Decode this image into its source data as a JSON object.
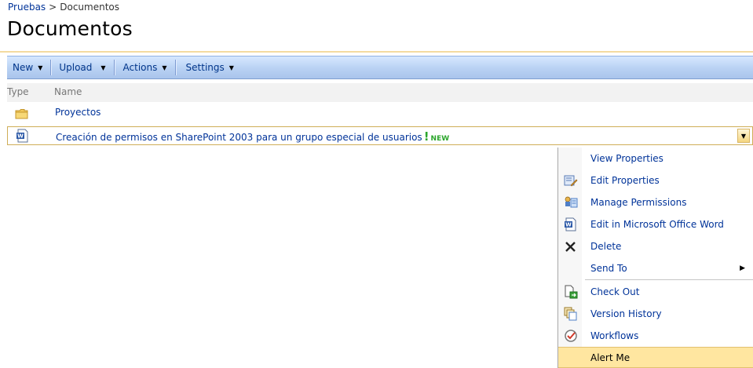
{
  "breadcrumb": {
    "parent": "Pruebas",
    "separator": ">",
    "current": "Documentos"
  },
  "page": {
    "title": "Documentos"
  },
  "toolbar": {
    "items": [
      {
        "label": "New",
        "icon": "chevron-down-icon"
      },
      {
        "label": "Upload",
        "icon": "chevron-down-icon"
      },
      {
        "label": "Actions",
        "icon": "chevron-down-icon"
      },
      {
        "label": "Settings",
        "icon": "chevron-down-icon"
      }
    ]
  },
  "list": {
    "columns": {
      "type": "Type",
      "name": "Name"
    },
    "rows": [
      {
        "type_icon": "folder-icon",
        "name": "Proyectos"
      },
      {
        "type_icon": "word-document-icon",
        "name": "Creación de permisos en SharePoint 2003 para un grupo especial de usuarios",
        "new_mark": "!",
        "new_label": "NEW"
      }
    ]
  },
  "context_menu": {
    "items": [
      {
        "label": "View Properties",
        "icon": ""
      },
      {
        "label": "Edit Properties",
        "icon": "edit-properties-icon"
      },
      {
        "label": "Manage Permissions",
        "icon": "manage-permissions-icon"
      },
      {
        "label": "Edit in Microsoft Office Word",
        "icon": "word-document-icon"
      },
      {
        "label": "Delete",
        "icon": "delete-x-icon"
      },
      {
        "label": "Send To",
        "icon": "",
        "submenu_arrow": "▶"
      },
      {
        "label": "Check Out",
        "icon": "check-out-icon"
      },
      {
        "label": "Version History",
        "icon": "version-history-icon"
      },
      {
        "label": "Workflows",
        "icon": "workflows-icon"
      },
      {
        "label": "Alert Me",
        "icon": ""
      }
    ],
    "highlighted": "Alert Me"
  },
  "colors": {
    "link": "#003399",
    "toolbar_bg": "#b9d1f3",
    "accent_rule": "#f3dba0",
    "highlight": "#ffe6a0",
    "new_badge": "#2ca62c"
  }
}
